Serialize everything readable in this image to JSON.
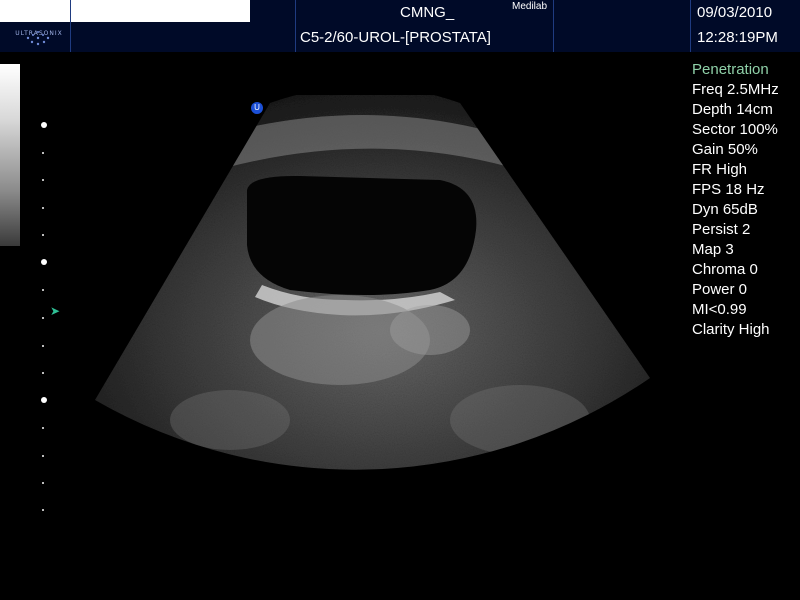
{
  "header": {
    "logo_text": "ULTRASONIX",
    "site_name": "CMNG_",
    "site_sub": "Medilab",
    "probe_preset": "C5-2/60-UROL-[PROSTATA]",
    "date": "09/03/2010",
    "time": "12:28:19PM"
  },
  "params": {
    "mode": "Penetration",
    "items": [
      "Freq 2.5MHz",
      "Depth 14cm",
      "Sector 100%",
      "Gain 50%",
      "FR High",
      "FPS 18 Hz",
      "Dyn 65dB",
      "Persist 2",
      "Map 3",
      "Chroma 0",
      "Power 0",
      "MI<0.99",
      "Clarity High"
    ]
  },
  "markers": {
    "orientation": "U"
  },
  "colors": {
    "header_bg": "#000a28",
    "mode_text": "#8fd0a8",
    "focus_marker": "#2fbf95",
    "orientation_marker": "#1b4fd6"
  }
}
